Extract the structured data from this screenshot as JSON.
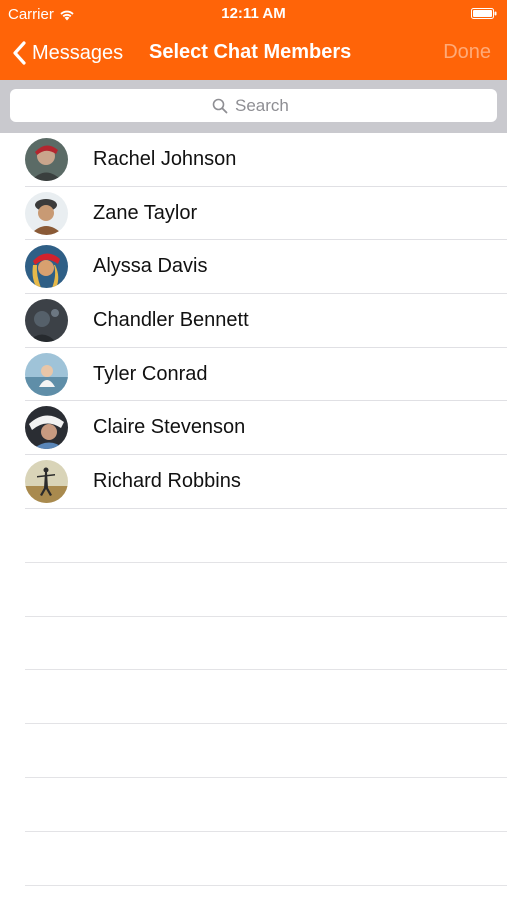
{
  "status_bar": {
    "carrier": "Carrier",
    "time": "12:11 AM"
  },
  "nav": {
    "back_label": "Messages",
    "title": "Select Chat Members",
    "done_label": "Done"
  },
  "search": {
    "placeholder": "Search",
    "value": ""
  },
  "contacts": [
    {
      "name": "Rachel Johnson"
    },
    {
      "name": "Zane Taylor"
    },
    {
      "name": "Alyssa Davis"
    },
    {
      "name": "Chandler Bennett"
    },
    {
      "name": "Tyler Conrad"
    },
    {
      "name": "Claire Stevenson"
    },
    {
      "name": "Richard Robbins"
    }
  ],
  "colors": {
    "accent": "#ff6408",
    "search_background": "#c9c9ce",
    "separator": "#e0e0e4"
  }
}
